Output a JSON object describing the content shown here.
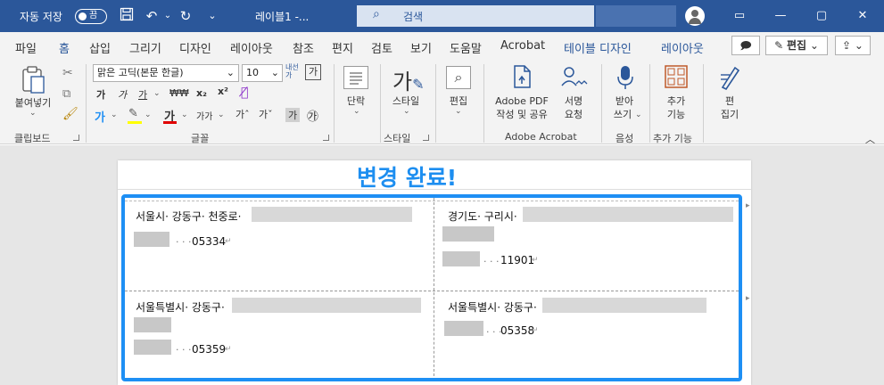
{
  "titlebar": {
    "autosave_label": "자동 저장",
    "autosave_state": "끔",
    "doc_title": "레이블1  -...",
    "search_placeholder": "검색"
  },
  "tabs": [
    "파일",
    "홈",
    "삽입",
    "그리기",
    "디자인",
    "레이아웃",
    "참조",
    "편지",
    "검토",
    "보기",
    "도움말",
    "Acrobat",
    "테이블 디자인",
    "레이아웃"
  ],
  "tab_right": {
    "edit_label": "편집"
  },
  "ribbon": {
    "clipboard": {
      "paste_label": "붙여넣기",
      "group_label": "클립보드"
    },
    "font": {
      "font_name": "맑은 고딕(본문 한글)",
      "font_size": "10",
      "group_label": "글꼴",
      "b_label": "가",
      "i_label": "가",
      "u_label": "가",
      "strike_label": "₩₩",
      "sub_label": "x₂",
      "sup_label": "x²",
      "grow_label": "가ˆ",
      "shrink_label": "가ˇ",
      "inner_label": "내선",
      "box_label": "가",
      "circle_label": "㉮",
      "aa_label": "가가",
      "highlight_label": "가"
    },
    "paragraph": {
      "label": "단락"
    },
    "style": {
      "label": "스타일",
      "group_label": "스타일"
    },
    "edit": {
      "label": "편집"
    },
    "acrobat": {
      "pdf_label_1": "Adobe PDF",
      "pdf_label_2": "작성 및 공유",
      "sign_label_1": "서명",
      "sign_label_2": "요청",
      "group_label": "Adobe Acrobat"
    },
    "voice": {
      "label_1": "받아",
      "label_2": "쓰기",
      "group_label": "음성"
    },
    "addin": {
      "label_1": "추가",
      "label_2": "기능",
      "group_label": "추가 기능"
    },
    "editor": {
      "label_1": "편",
      "label_2": "집기"
    }
  },
  "document": {
    "heading": "변경 완료!",
    "cells": [
      {
        "addr": "서울시· 강동구· 천중로·",
        "zip": "05334"
      },
      {
        "addr": "경기도· 구리시·",
        "zip": "11901"
      },
      {
        "addr": "서울특별시· 강동구·",
        "zip": "05359"
      },
      {
        "addr": "서울특별시· 강동구·",
        "zip": "05358"
      }
    ],
    "zip_prefix": "· · ·"
  }
}
